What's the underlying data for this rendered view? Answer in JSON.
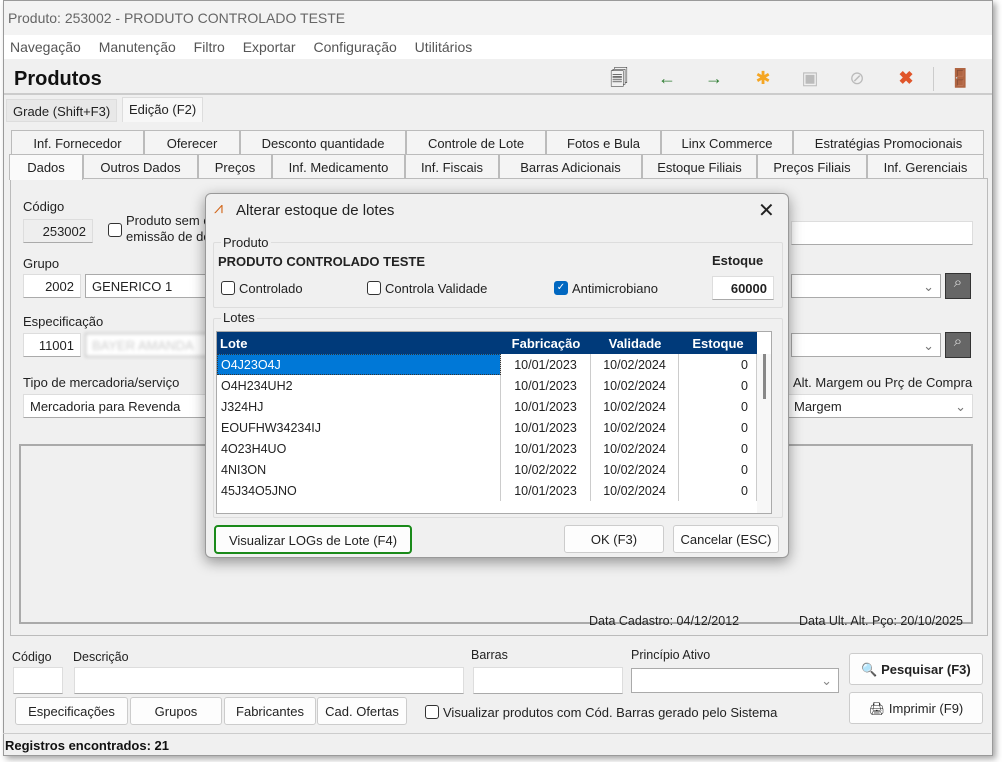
{
  "window": {
    "title": "Produto: 253002 - PRODUTO CONTROLADO TESTE"
  },
  "menu": [
    "Navegação",
    "Manutenção",
    "Filtro",
    "Exportar",
    "Configuração",
    "Utilitários"
  ],
  "header": {
    "title": "Produtos"
  },
  "toolbar": [
    {
      "icon": "copy-icon"
    },
    {
      "icon": "arrow-left-icon"
    },
    {
      "icon": "arrow-right-icon"
    },
    {
      "icon": "new-icon"
    },
    {
      "icon": "save-icon"
    },
    {
      "icon": "cancel-icon"
    },
    {
      "icon": "delete-icon"
    },
    {
      "icon": "exit-icon"
    }
  ],
  "view_tabs": [
    "Grade (Shift+F3)",
    "Edição (F2)"
  ],
  "tabs_row1": [
    "Inf. Fornecedor",
    "Oferecer",
    "Desconto quantidade",
    "Controle de Lote",
    "Fotos e Bula",
    "Linx Commerce",
    "Estratégias Promocionais"
  ],
  "tabs_row2": [
    "Dados",
    "Outros Dados",
    "Preços",
    "Inf. Medicamento",
    "Inf. Fiscais",
    "Barras Adicionais",
    "Estoque Filiais",
    "Preços Filiais",
    "Inf. Gerenciais"
  ],
  "form": {
    "codigo_label": "Código",
    "codigo": "253002",
    "sem_label_1": "Produto sem c",
    "sem_label_2": "emissão de do",
    "grupo_label": "Grupo",
    "grupo_code": "2002",
    "grupo_name": "GENERICO 1",
    "espec_label": "Especificação",
    "espec_code": "11001",
    "espec_name": "BAYER AMANDA",
    "tipo_label": "Tipo de mercadoria/serviço",
    "tipo_value": "Mercadoria para Revenda",
    "alt_label": "Alt. Margem ou Prç de Compra",
    "alt_value": "Margem",
    "data_cadastro": "Data Cadastro:  04/12/2012",
    "data_ult": "Data Ult. Alt. Pço:  20/10/2025"
  },
  "dialog": {
    "title": "Alterar estoque de lotes",
    "produto_group": "Produto",
    "produto_name": "PRODUTO CONTROLADO TESTE",
    "estoque_label": "Estoque",
    "estoque_value": "60000",
    "checks": [
      {
        "label": "Controlado",
        "checked": false
      },
      {
        "label": "Controla Validade",
        "checked": false
      },
      {
        "label": "Antimicrobiano",
        "checked": true
      }
    ],
    "lotes_group": "Lotes",
    "columns": [
      "Lote",
      "Fabricação",
      "Validade",
      "Estoque"
    ],
    "rows": [
      [
        "O4J23O4J",
        "10/01/2023",
        "10/02/2024",
        "0"
      ],
      [
        "O4H234UH2",
        "10/01/2023",
        "10/02/2024",
        "0"
      ],
      [
        "J324HJ",
        "10/01/2023",
        "10/02/2024",
        "0"
      ],
      [
        "EOUFHW34234IJ",
        "10/01/2023",
        "10/02/2024",
        "0"
      ],
      [
        "4O23H4UO",
        "10/01/2023",
        "10/02/2024",
        "0"
      ],
      [
        "4NI3ON",
        "10/02/2022",
        "10/02/2024",
        "0"
      ],
      [
        "45J34O5JNO",
        "10/01/2023",
        "10/02/2024",
        "0"
      ]
    ],
    "logs_button": "Visualizar LOGs de Lote (F4)",
    "ok_button": "OK (F3)",
    "cancel_button": "Cancelar (ESC)",
    "highlight_color": "#1a8a1a",
    "selection_color": "#0078d7",
    "header_color": "#003a7a"
  },
  "search": {
    "codigo_label": "Código",
    "descricao_label": "Descrição",
    "barras_label": "Barras",
    "principio_label": "Princípio Ativo",
    "pesquisar": "Pesquisar (F3)",
    "imprimir": "Imprimir (F9)",
    "buttons": [
      "Especificações",
      "Grupos",
      "Fabricantes",
      "Cad. Ofertas"
    ],
    "checkbox_label": "Visualizar produtos com Cód. Barras gerado pelo Sistema"
  },
  "status": "Registros encontrados: 21"
}
